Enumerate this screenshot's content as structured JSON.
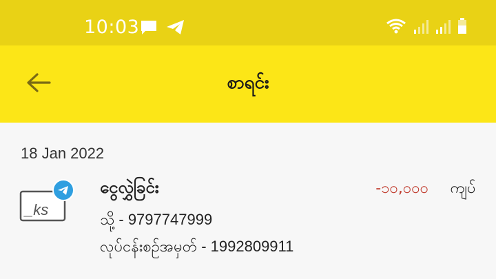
{
  "status_bar": {
    "time": "10:03",
    "icons": [
      "message-icon",
      "telegram-icon",
      "wifi-icon",
      "signal-icon",
      "signal-icon",
      "battery-icon"
    ]
  },
  "app_bar": {
    "title": "စာရင်း"
  },
  "transactions": {
    "date": "18 Jan 2022",
    "items": [
      {
        "title": "ငွေလွှဲခြင်း",
        "amount": "-၁၀,၀၀၀",
        "currency": "ကျပ်",
        "to_line": "သို့ - 9797747999",
        "ref_line": "လုပ်ငန်းစဉ်အမှတ် - 1992809911",
        "logo_text": "_ks"
      }
    ]
  },
  "colors": {
    "status_bar": "#e9d215",
    "app_bar": "#fce617",
    "amount_negative": "#c0392b",
    "telegram_badge": "#2f9fe0"
  }
}
